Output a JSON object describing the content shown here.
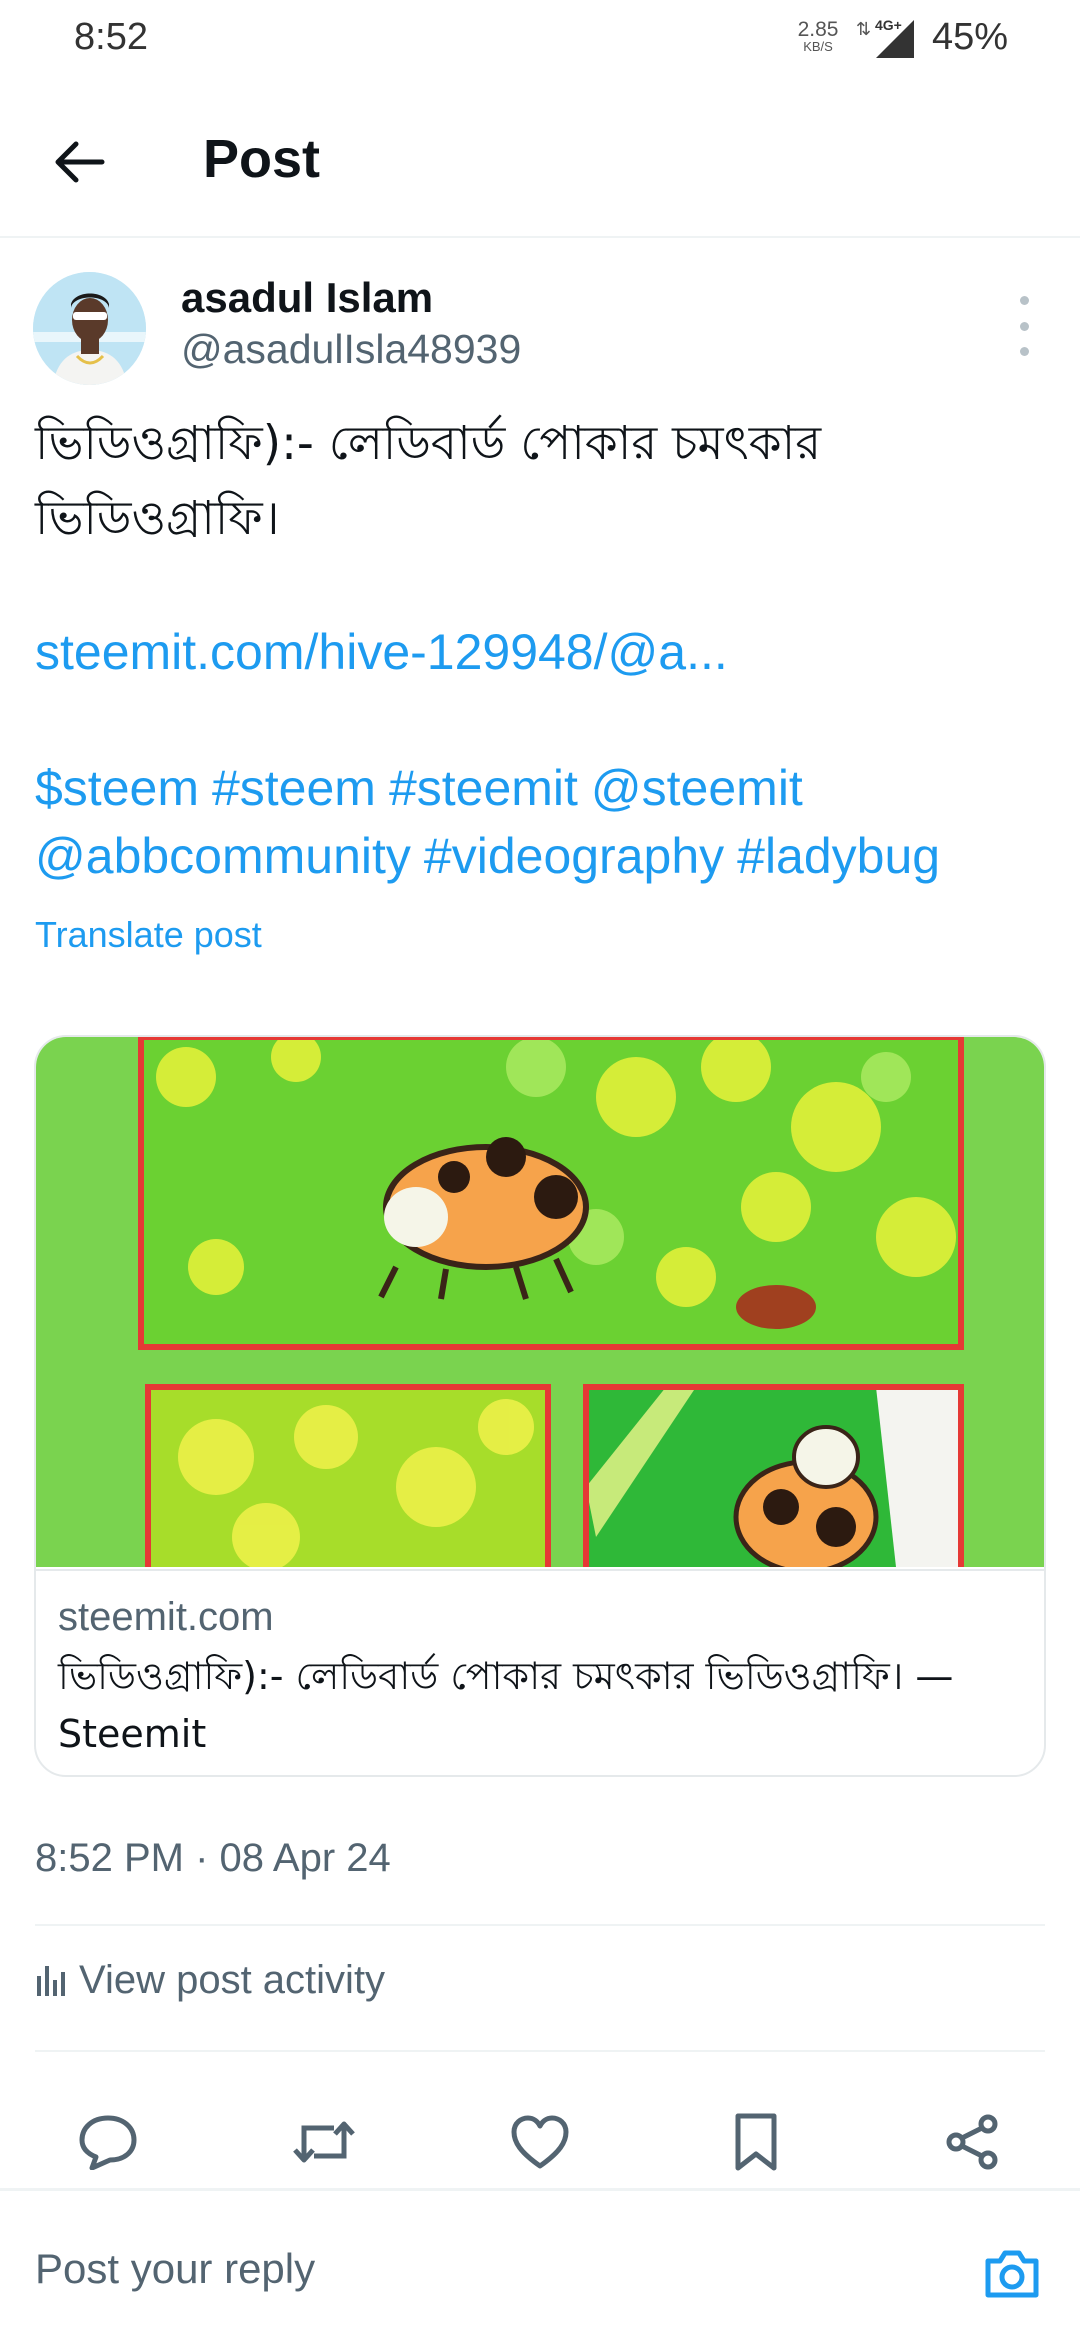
{
  "status_bar": {
    "time": "8:52",
    "net_speed": "2.85",
    "net_speed_unit": "KB/S",
    "network": "4G+",
    "battery": "45%"
  },
  "header": {
    "title": "Post"
  },
  "post": {
    "author_name": "asadul Islam",
    "author_handle": "@asadulIsla48939",
    "text": "ভিডিওগ্রাফি):- লেডিবার্ড পোকার চমৎকার ভিডিওগ্রাফি।",
    "link": "steemit.com/hive-129948/@a...",
    "tags": [
      "$steem",
      "#steem",
      "#steemit",
      "@steemit",
      "@abbcommunity",
      "#videography",
      "#ladybug"
    ],
    "translate_label": "Translate post",
    "card": {
      "domain": "steemit.com",
      "title": "ভিডিওগ্রাফি):- লেডিবার্ড পোকার চমৎকার ভিডিওগ্রাফি। — Steemit"
    },
    "timestamp": "8:52 PM · 08 Apr 24",
    "activity_label": "View post activity"
  },
  "actions": {
    "icons": [
      "reply-icon",
      "repost-icon",
      "like-icon",
      "bookmark-icon",
      "share-icon"
    ]
  },
  "reply": {
    "placeholder": "Post your reply"
  },
  "colors": {
    "accent": "#1d9bf0",
    "secondary_text": "#536471",
    "image_bg": "#7ad34f",
    "frame": "#e53935"
  }
}
